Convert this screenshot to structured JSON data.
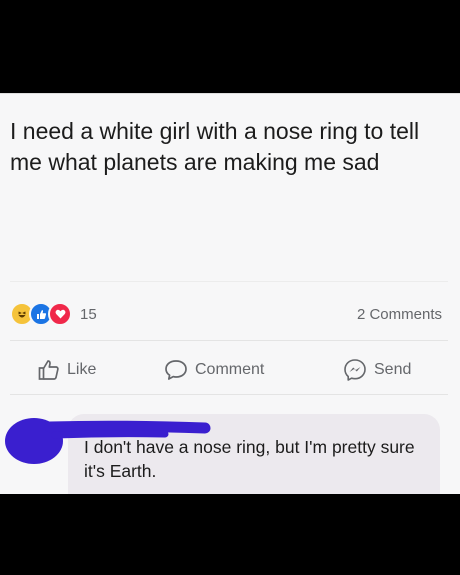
{
  "post": {
    "text": "I need a white girl with a nose ring to tell me what planets are making me sad"
  },
  "reactions": {
    "icons": [
      "haha-icon",
      "like-icon",
      "love-icon"
    ],
    "count": "15",
    "comments_count": "2 Comments"
  },
  "actions": {
    "like_label": "Like",
    "comment_label": "Comment",
    "send_label": "Send"
  },
  "comment": {
    "text": "I don't have a nose ring, but I'm pretty sure it's Earth."
  },
  "colors": {
    "scribble": "#3a1fcf",
    "like_blue": "#1b74e4",
    "love_red": "#f0284a",
    "haha_yellow": "#f5c33b"
  }
}
